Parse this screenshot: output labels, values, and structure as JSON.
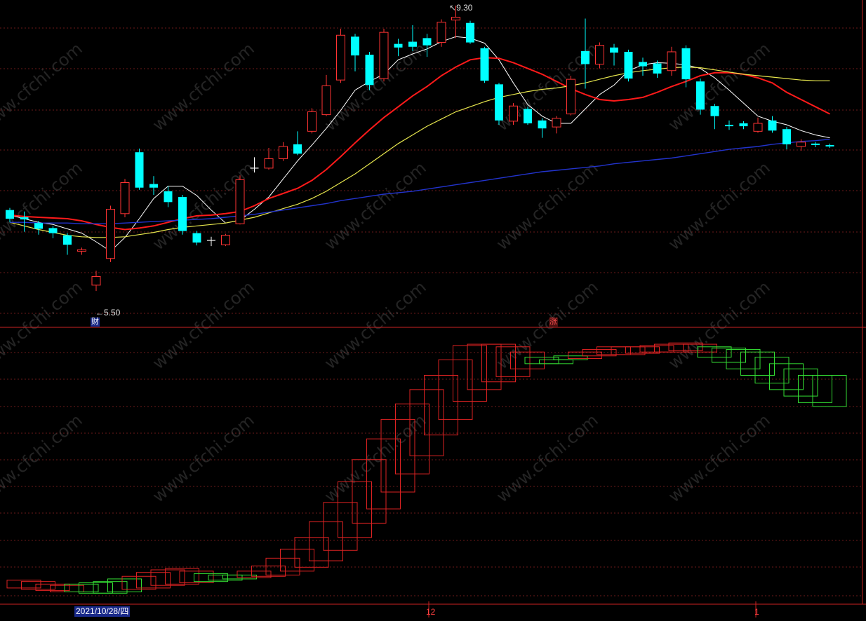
{
  "watermark": "www.cfchi.com",
  "colors": {
    "up": "#ff3333",
    "down": "#00ffff",
    "ma5": "#ffffff",
    "ma10": "#ff1a1a",
    "ma20": "#e6e64d",
    "ma60": "#2233cc",
    "divider": "#cc2222",
    "grid": "#6b1a1a",
    "box_up": "#dd2222",
    "box_down": "#33dd33"
  },
  "labels": {
    "high_price": "9.30",
    "low_price": "5.50",
    "badge_finance": "财",
    "badge_rise": "涨",
    "date": "2021/10/28/四",
    "tick_dec": "12",
    "tick_jan": "1"
  },
  "chart_data": {
    "type": "candlestick",
    "title": "",
    "ylim": [
      5.2,
      9.45
    ],
    "high_label": 9.3,
    "low_label": 5.5,
    "candles": [
      {
        "o": 6.62,
        "c": 6.5,
        "h": 6.65,
        "l": 6.45
      },
      {
        "o": 6.52,
        "c": 6.49,
        "h": 6.6,
        "l": 6.32
      },
      {
        "o": 6.44,
        "c": 6.36,
        "h": 6.47,
        "l": 6.28
      },
      {
        "o": 6.37,
        "c": 6.3,
        "h": 6.4,
        "l": 6.23
      },
      {
        "o": 6.27,
        "c": 6.14,
        "h": 6.3,
        "l": 6.0
      },
      {
        "o": 6.05,
        "c": 6.07,
        "h": 6.1,
        "l": 6.0
      },
      {
        "o": 5.58,
        "c": 5.7,
        "h": 5.78,
        "l": 5.5
      },
      {
        "o": 5.95,
        "c": 6.63,
        "h": 6.68,
        "l": 5.9
      },
      {
        "o": 6.57,
        "c": 7.0,
        "h": 7.05,
        "l": 6.52
      },
      {
        "o": 7.42,
        "c": 6.93,
        "h": 7.47,
        "l": 6.9
      },
      {
        "o": 6.98,
        "c": 6.93,
        "h": 7.09,
        "l": 6.83
      },
      {
        "o": 6.88,
        "c": 6.73,
        "h": 6.95,
        "l": 6.66
      },
      {
        "o": 6.8,
        "c": 6.33,
        "h": 6.83,
        "l": 6.28
      },
      {
        "o": 6.3,
        "c": 6.17,
        "h": 6.33,
        "l": 6.13
      },
      {
        "o": 6.2,
        "c": 6.2,
        "h": 6.25,
        "l": 6.12
      },
      {
        "o": 6.14,
        "c": 6.27,
        "h": 6.29,
        "l": 6.12
      },
      {
        "o": 6.43,
        "c": 7.04,
        "h": 7.1,
        "l": 6.42
      },
      {
        "o": 7.2,
        "c": 7.19,
        "h": 7.35,
        "l": 7.14
      },
      {
        "o": 7.2,
        "c": 7.33,
        "h": 7.48,
        "l": 7.18
      },
      {
        "o": 7.33,
        "c": 7.5,
        "h": 7.56,
        "l": 7.3
      },
      {
        "o": 7.53,
        "c": 7.4,
        "h": 7.71,
        "l": 7.38
      },
      {
        "o": 7.71,
        "c": 7.98,
        "h": 8.03,
        "l": 7.68
      },
      {
        "o": 7.94,
        "c": 8.34,
        "h": 8.49,
        "l": 7.92
      },
      {
        "o": 8.42,
        "c": 9.04,
        "h": 9.13,
        "l": 8.38
      },
      {
        "o": 9.02,
        "c": 8.76,
        "h": 9.06,
        "l": 8.54
      },
      {
        "o": 8.77,
        "c": 8.35,
        "h": 8.81,
        "l": 8.28
      },
      {
        "o": 8.44,
        "c": 9.08,
        "h": 9.13,
        "l": 8.4
      },
      {
        "o": 8.92,
        "c": 8.87,
        "h": 8.99,
        "l": 8.75
      },
      {
        "o": 8.95,
        "c": 8.88,
        "h": 9.18,
        "l": 8.82
      },
      {
        "o": 9.0,
        "c": 8.9,
        "h": 9.06,
        "l": 8.74
      },
      {
        "o": 8.94,
        "c": 9.22,
        "h": 9.26,
        "l": 8.88
      },
      {
        "o": 9.25,
        "c": 9.29,
        "h": 9.45,
        "l": 9.0
      },
      {
        "o": 9.21,
        "c": 8.94,
        "h": 9.24,
        "l": 8.92
      },
      {
        "o": 8.86,
        "c": 8.41,
        "h": 8.88,
        "l": 8.38
      },
      {
        "o": 8.36,
        "c": 7.86,
        "h": 8.38,
        "l": 7.8
      },
      {
        "o": 7.85,
        "c": 8.06,
        "h": 8.1,
        "l": 7.8
      },
      {
        "o": 8.02,
        "c": 7.82,
        "h": 8.05,
        "l": 7.8
      },
      {
        "o": 7.86,
        "c": 7.75,
        "h": 7.89,
        "l": 7.62
      },
      {
        "o": 7.77,
        "c": 7.89,
        "h": 7.92,
        "l": 7.68
      },
      {
        "o": 7.95,
        "c": 8.43,
        "h": 8.48,
        "l": 7.93
      },
      {
        "o": 8.82,
        "c": 8.64,
        "h": 9.27,
        "l": 8.3
      },
      {
        "o": 8.64,
        "c": 8.9,
        "h": 8.94,
        "l": 8.58
      },
      {
        "o": 8.87,
        "c": 8.8,
        "h": 8.92,
        "l": 8.62
      },
      {
        "o": 8.81,
        "c": 8.44,
        "h": 8.84,
        "l": 8.4
      },
      {
        "o": 8.67,
        "c": 8.61,
        "h": 8.73,
        "l": 8.48
      },
      {
        "o": 8.65,
        "c": 8.51,
        "h": 8.69,
        "l": 8.45
      },
      {
        "o": 8.55,
        "c": 8.81,
        "h": 8.88,
        "l": 8.48
      },
      {
        "o": 8.86,
        "c": 8.43,
        "h": 8.9,
        "l": 8.32
      },
      {
        "o": 8.4,
        "c": 8.01,
        "h": 8.44,
        "l": 7.94
      },
      {
        "o": 8.06,
        "c": 7.92,
        "h": 8.09,
        "l": 7.74
      },
      {
        "o": 7.8,
        "c": 7.78,
        "h": 7.86,
        "l": 7.73
      },
      {
        "o": 7.82,
        "c": 7.78,
        "h": 7.85,
        "l": 7.74
      },
      {
        "o": 7.71,
        "c": 7.82,
        "h": 7.9,
        "l": 7.69
      },
      {
        "o": 7.86,
        "c": 7.72,
        "h": 7.92,
        "l": 7.69
      },
      {
        "o": 7.74,
        "c": 7.53,
        "h": 7.77,
        "l": 7.46
      },
      {
        "o": 7.5,
        "c": 7.56,
        "h": 7.6,
        "l": 7.44
      },
      {
        "o": 7.54,
        "c": 7.52,
        "h": 7.56,
        "l": 7.49
      },
      {
        "o": 7.52,
        "c": 7.5,
        "h": 7.54,
        "l": 7.48
      }
    ],
    "series": [
      {
        "key": "ma5",
        "values": [
          6.55,
          6.5,
          6.45,
          6.42,
          6.36,
          6.3,
          6.18,
          6.05,
          6.24,
          6.5,
          6.78,
          6.95,
          6.95,
          6.82,
          6.62,
          6.44,
          6.48,
          6.63,
          6.8,
          7.05,
          7.3,
          7.52,
          7.75,
          8.0,
          8.28,
          8.4,
          8.5,
          8.7,
          8.78,
          8.85,
          8.95,
          9.02,
          9.0,
          8.93,
          8.7,
          8.38,
          8.08,
          7.92,
          7.82,
          7.82,
          8.02,
          8.22,
          8.35,
          8.55,
          8.63,
          8.66,
          8.65,
          8.63,
          8.58,
          8.45,
          8.28,
          8.1,
          7.92,
          7.85,
          7.8,
          7.72,
          7.66,
          7.62
        ]
      },
      {
        "key": "ma10",
        "values": [
          6.55,
          6.53,
          6.52,
          6.51,
          6.5,
          6.47,
          6.42,
          6.38,
          6.35,
          6.37,
          6.4,
          6.45,
          6.5,
          6.54,
          6.55,
          6.57,
          6.6,
          6.68,
          6.78,
          6.85,
          6.92,
          7.03,
          7.18,
          7.36,
          7.55,
          7.73,
          7.9,
          8.05,
          8.2,
          8.33,
          8.48,
          8.6,
          8.7,
          8.73,
          8.72,
          8.66,
          8.58,
          8.5,
          8.4,
          8.3,
          8.22,
          8.15,
          8.13,
          8.15,
          8.18,
          8.25,
          8.33,
          8.4,
          8.48,
          8.52,
          8.52,
          8.5,
          8.45,
          8.38,
          8.25,
          8.15,
          8.05,
          7.95
        ]
      },
      {
        "key": "ma20",
        "values": [
          6.45,
          6.4,
          6.35,
          6.31,
          6.27,
          6.25,
          6.24,
          6.24,
          6.25,
          6.28,
          6.31,
          6.35,
          6.38,
          6.4,
          6.42,
          6.44,
          6.48,
          6.52,
          6.58,
          6.64,
          6.7,
          6.78,
          6.88,
          7.0,
          7.12,
          7.26,
          7.4,
          7.54,
          7.66,
          7.78,
          7.88,
          7.98,
          8.05,
          8.12,
          8.18,
          8.22,
          8.26,
          8.29,
          8.31,
          8.34,
          8.38,
          8.43,
          8.48,
          8.52,
          8.55,
          8.57,
          8.59,
          8.6,
          8.59,
          8.56,
          8.53,
          8.5,
          8.48,
          8.46,
          8.44,
          8.42,
          8.41,
          8.41
        ]
      },
      {
        "key": "ma60",
        "values": [
          6.45,
          6.45,
          6.44,
          6.44,
          6.44,
          6.43,
          6.43,
          6.43,
          6.44,
          6.45,
          6.46,
          6.47,
          6.48,
          6.49,
          6.5,
          6.52,
          6.54,
          6.56,
          6.59,
          6.62,
          6.65,
          6.68,
          6.71,
          6.75,
          6.78,
          6.81,
          6.84,
          6.86,
          6.88,
          6.91,
          6.94,
          6.97,
          7.0,
          7.03,
          7.06,
          7.09,
          7.12,
          7.15,
          7.17,
          7.19,
          7.21,
          7.23,
          7.26,
          7.28,
          7.3,
          7.32,
          7.34,
          7.37,
          7.4,
          7.43,
          7.46,
          7.48,
          7.5,
          7.53,
          7.55,
          7.57,
          7.58,
          7.6
        ]
      }
    ],
    "lower_indicator": {
      "ylim": [
        0,
        100
      ],
      "boxes": [
        {
          "top": 6.0,
          "bottom": 3.0,
          "dir": "up"
        },
        {
          "top": 5.5,
          "bottom": 2.5,
          "dir": "up"
        },
        {
          "top": 4.5,
          "bottom": 2.0,
          "dir": "up"
        },
        {
          "top": 4.0,
          "bottom": 1.5,
          "dir": "up"
        },
        {
          "top": 4.5,
          "bottom": 1.5,
          "dir": "down"
        },
        {
          "top": 5.0,
          "bottom": 1.0,
          "dir": "down"
        },
        {
          "top": 5.5,
          "bottom": 1.0,
          "dir": "down"
        },
        {
          "top": 6.5,
          "bottom": 1.5,
          "dir": "down"
        },
        {
          "top": 7.5,
          "bottom": 2.5,
          "dir": "up"
        },
        {
          "top": 9.0,
          "bottom": 3.0,
          "dir": "up"
        },
        {
          "top": 10.0,
          "bottom": 4.0,
          "dir": "up"
        },
        {
          "top": 10.5,
          "bottom": 4.5,
          "dir": "up"
        },
        {
          "top": 9.5,
          "bottom": 5.0,
          "dir": "up"
        },
        {
          "top": 8.5,
          "bottom": 5.5,
          "dir": "down"
        },
        {
          "top": 8.0,
          "bottom": 6.0,
          "dir": "down"
        },
        {
          "top": 8.0,
          "bottom": 6.5,
          "dir": "down"
        },
        {
          "top": 9.5,
          "bottom": 7.0,
          "dir": "up"
        },
        {
          "top": 11.5,
          "bottom": 7.5,
          "dir": "up"
        },
        {
          "top": 14.5,
          "bottom": 8.0,
          "dir": "up"
        },
        {
          "top": 18.0,
          "bottom": 9.5,
          "dir": "up"
        },
        {
          "top": 22.5,
          "bottom": 11.0,
          "dir": "up"
        },
        {
          "top": 28.5,
          "bottom": 13.5,
          "dir": "up"
        },
        {
          "top": 36.0,
          "bottom": 17.5,
          "dir": "up"
        },
        {
          "top": 44.0,
          "bottom": 22.5,
          "dir": "up"
        },
        {
          "top": 52.5,
          "bottom": 28.0,
          "dir": "up"
        },
        {
          "top": 60.5,
          "bottom": 33.5,
          "dir": "up"
        },
        {
          "top": 68.0,
          "bottom": 40.0,
          "dir": "up"
        },
        {
          "top": 74.0,
          "bottom": 47.0,
          "dir": "up"
        },
        {
          "top": 79.5,
          "bottom": 54.0,
          "dir": "up"
        },
        {
          "top": 85.0,
          "bottom": 62.0,
          "dir": "up"
        },
        {
          "top": 91.0,
          "bottom": 68.0,
          "dir": "up"
        },
        {
          "top": 96.5,
          "bottom": 75.0,
          "dir": "up"
        },
        {
          "top": 97.0,
          "bottom": 79.5,
          "dir": "up"
        },
        {
          "top": 97.0,
          "bottom": 82.5,
          "dir": "up"
        },
        {
          "top": 96.0,
          "bottom": 84.5,
          "dir": "up"
        },
        {
          "top": 94.0,
          "bottom": 87.5,
          "dir": "up"
        },
        {
          "top": 92.0,
          "bottom": 89.5,
          "dir": "down"
        },
        {
          "top": 91.0,
          "bottom": 89.5,
          "dir": "down"
        },
        {
          "top": 92.5,
          "bottom": 91.0,
          "dir": "down"
        },
        {
          "top": 94.0,
          "bottom": 91.5,
          "dir": "up"
        },
        {
          "top": 95.0,
          "bottom": 92.5,
          "dir": "up"
        },
        {
          "top": 96.0,
          "bottom": 93.0,
          "dir": "up"
        },
        {
          "top": 96.0,
          "bottom": 93.0,
          "dir": "up"
        },
        {
          "top": 96.0,
          "bottom": 93.5,
          "dir": "up"
        },
        {
          "top": 96.5,
          "bottom": 94.0,
          "dir": "up"
        },
        {
          "top": 97.0,
          "bottom": 94.0,
          "dir": "up"
        },
        {
          "top": 97.5,
          "bottom": 94.5,
          "dir": "up"
        },
        {
          "top": 97.0,
          "bottom": 94.0,
          "dir": "up"
        },
        {
          "top": 96.0,
          "bottom": 92.0,
          "dir": "down"
        },
        {
          "top": 95.5,
          "bottom": 90.0,
          "dir": "down"
        },
        {
          "top": 95.0,
          "bottom": 87.5,
          "dir": "down"
        },
        {
          "top": 94.0,
          "bottom": 85.0,
          "dir": "down"
        },
        {
          "top": 92.0,
          "bottom": 82.0,
          "dir": "down"
        },
        {
          "top": 89.5,
          "bottom": 79.5,
          "dir": "down"
        },
        {
          "top": 87.5,
          "bottom": 77.0,
          "dir": "down"
        },
        {
          "top": 85.0,
          "bottom": 74.5,
          "dir": "down"
        },
        {
          "top": 85.0,
          "bottom": 73.0,
          "dir": "down"
        }
      ]
    }
  }
}
